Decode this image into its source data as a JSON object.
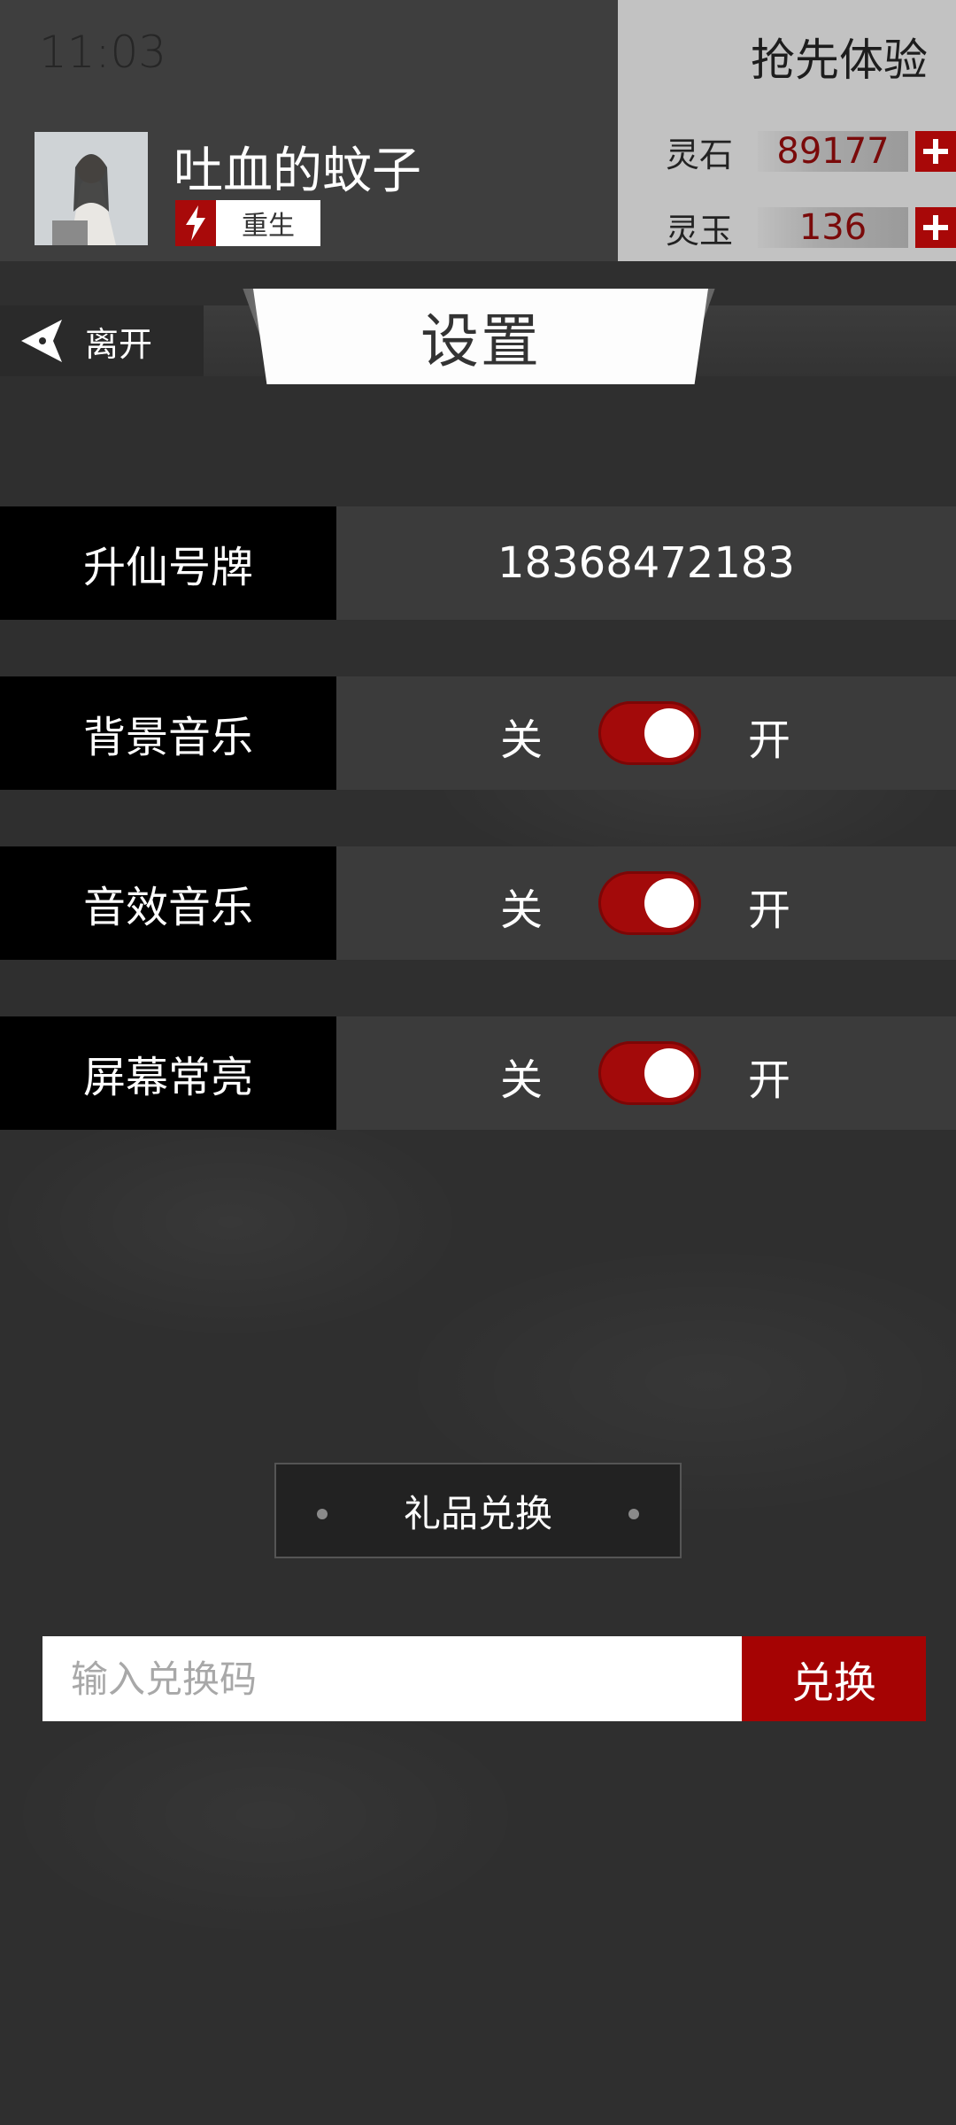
{
  "status_bar": {
    "time": "11:03"
  },
  "promo": {
    "label": "抢先体验"
  },
  "player": {
    "name": "吐血的蚊子",
    "tag": "重生"
  },
  "currencies": [
    {
      "label": "灵石",
      "value": "89177"
    },
    {
      "label": "灵玉",
      "value": "136"
    }
  ],
  "title_bar": {
    "back_label": "离开",
    "title": "设置"
  },
  "account": {
    "label": "升仙号牌",
    "value": "18368472183"
  },
  "toggles": [
    {
      "label": "背景音乐",
      "off": "关",
      "on": "开"
    },
    {
      "label": "音效音乐",
      "off": "关",
      "on": "开"
    },
    {
      "label": "屏幕常亮",
      "off": "关",
      "on": "开"
    }
  ],
  "gift": {
    "title": "礼品兑换",
    "placeholder": "输入兑换码",
    "button": "兑换"
  },
  "colors": {
    "accent": "#a50303",
    "panel": "#3b3b3b",
    "label_bg": "#000000"
  },
  "icons": {
    "back": "back-arrow-icon",
    "tag": "lightning-icon",
    "add": "plus-icon"
  }
}
